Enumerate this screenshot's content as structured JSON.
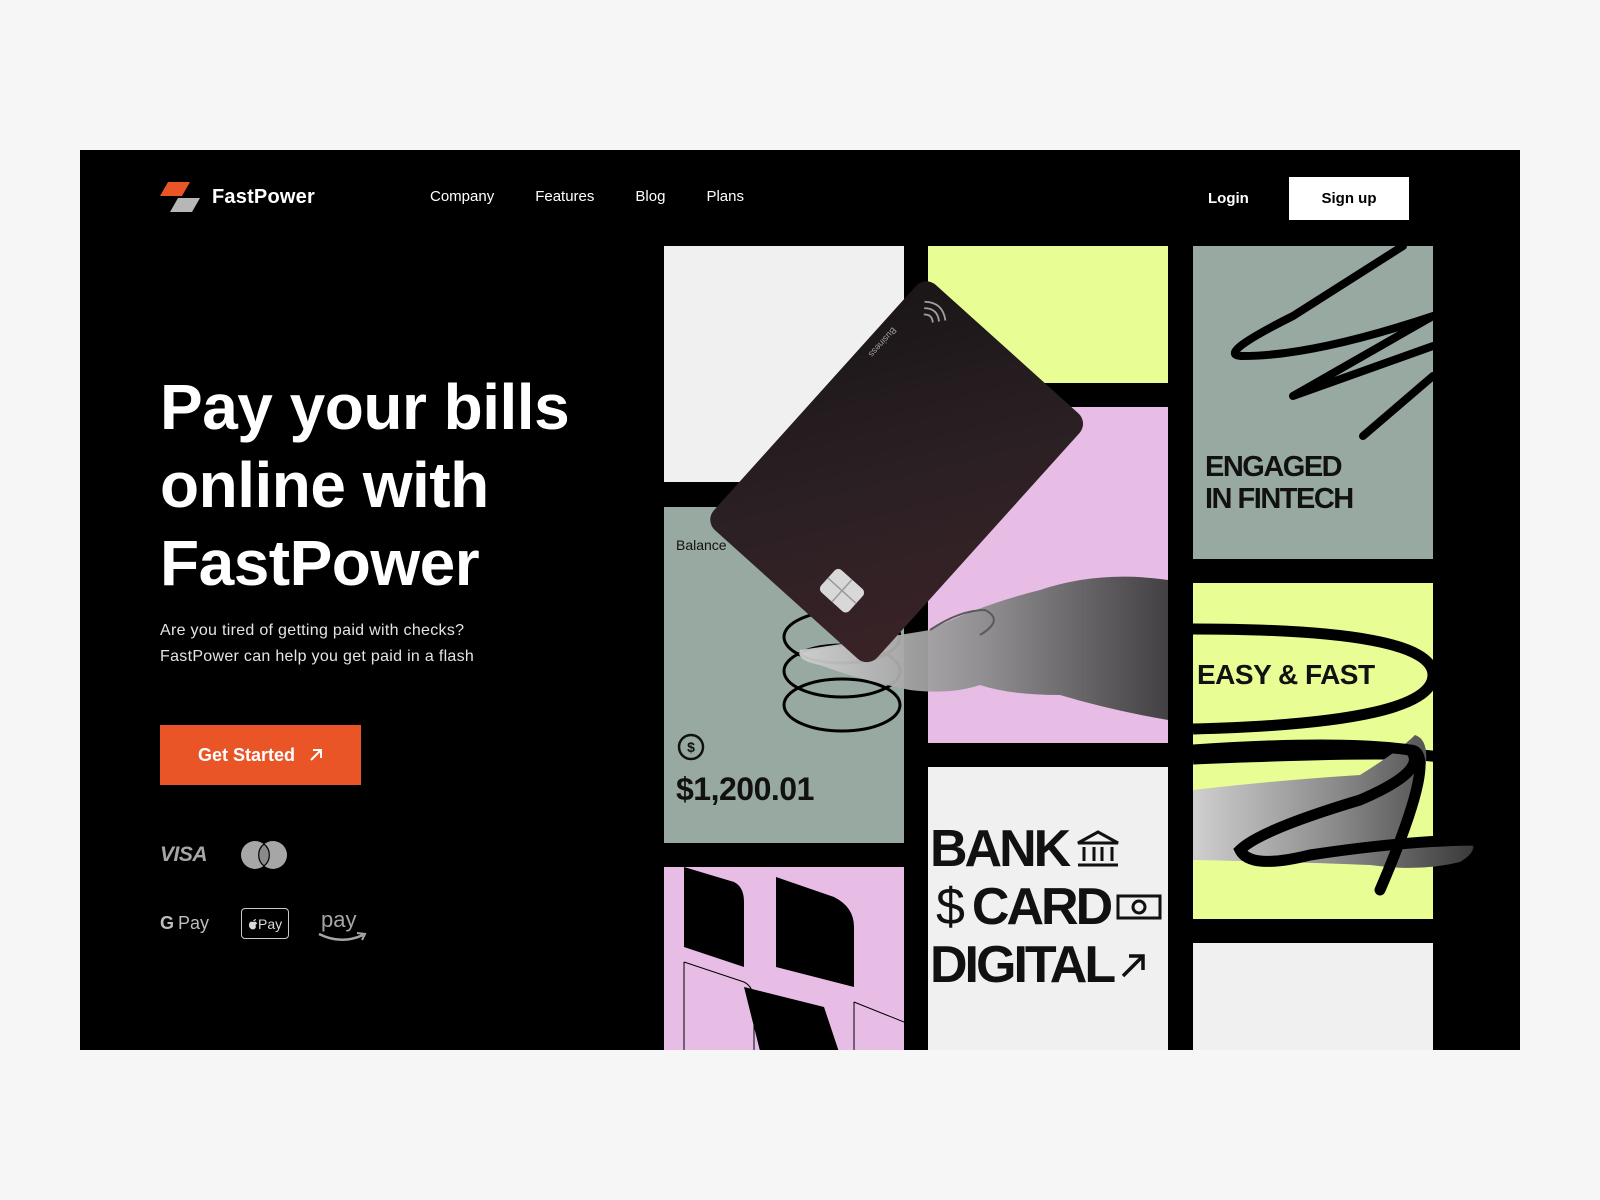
{
  "brand": {
    "name": "FastPower",
    "accent": "#ea5527"
  },
  "nav": {
    "items": [
      {
        "label": "Company"
      },
      {
        "label": "Features"
      },
      {
        "label": "Blog"
      },
      {
        "label": "Plans"
      }
    ],
    "login": "Login",
    "signup": "Sign up"
  },
  "hero": {
    "title_lines": [
      "Pay your bills",
      "online with",
      "FastPower"
    ],
    "subtitle_lines": [
      "Are you tired of getting paid with checks?",
      "FastPower can help you get paid in a flash"
    ],
    "cta": "Get Started"
  },
  "payments": {
    "visa": "VISA",
    "gpay": "Pay",
    "applepay": "Pay",
    "amazonpay": "pay"
  },
  "tiles": {
    "balance_label": "Balance",
    "balance_amount": "$1,200.01",
    "card_brand": "Business",
    "fintech_lines": [
      "ENGAGED",
      "IN FINTECH"
    ],
    "easy_fast": "EASY & FAST",
    "bank": "BANK",
    "card": "CARD",
    "dollar": "$",
    "digital": "DIGITAL"
  },
  "colors": {
    "lime": "#e8fd94",
    "pink": "#e7bde6",
    "sage": "#97a9a0",
    "light": "#f0f0f0"
  }
}
